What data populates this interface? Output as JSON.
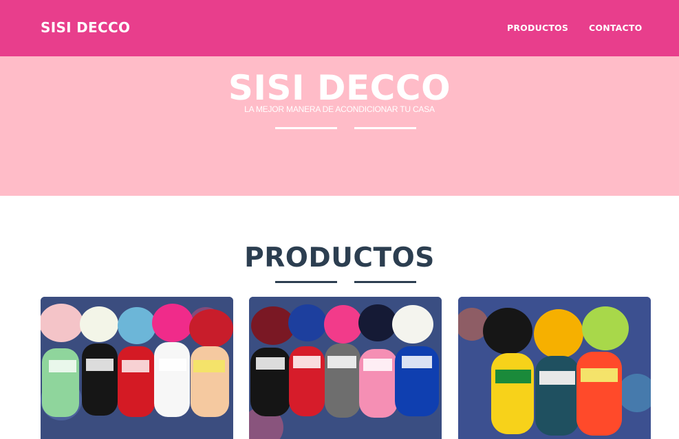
{
  "navbar": {
    "brand": "SISI DECCO",
    "links": [
      "PRODUCTOS",
      "CONTACTO"
    ],
    "background_color": "#e83e8c"
  },
  "hero": {
    "title": "SISI DECCO",
    "subtitle": "LA MEJOR MANERA DE ACONDICIONAR TU CASA",
    "background_color": "#ffbcc8"
  },
  "products": {
    "heading": "PRODUCTOS",
    "heading_color": "#2c3e50",
    "items": [
      {
        "image": "yarn-balls-photo-1"
      },
      {
        "image": "yarn-balls-photo-2"
      },
      {
        "image": "yarn-balls-photo-3"
      }
    ]
  }
}
